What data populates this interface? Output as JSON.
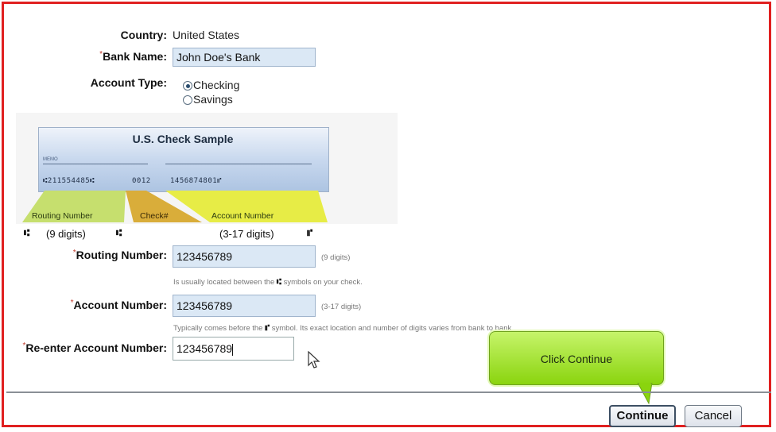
{
  "form": {
    "country_label": "Country:",
    "country_value": "United States",
    "bank_name_label": "Bank Name:",
    "bank_name_value": "John Doe's Bank",
    "account_type_label": "Account Type:",
    "account_type_options": [
      "Checking",
      "Savings"
    ],
    "account_type_selected": "Checking",
    "required_mark": "*"
  },
  "check_sample": {
    "title": "U.S. Check Sample",
    "memo_label": "MEMO",
    "micr_routing": "⑆211554485⑆",
    "micr_check": "0012",
    "micr_account": "1456874801⑈",
    "routing_tab": "Routing Number",
    "check_tab": "Check#",
    "account_tab": "Account Number",
    "routing_symbol": "⑆",
    "account_symbol": "⑈",
    "routing_digits": "(9 digits)",
    "account_digits": "(3-17 digits)"
  },
  "routing": {
    "label": "Routing Number:",
    "value": "123456789",
    "digits_hint": "(9 digits)",
    "help_before": "Is usually located between the",
    "help_after": "symbols on your check."
  },
  "account": {
    "label": "Account Number:",
    "value": "123456789",
    "digits_hint": "(3-17 digits)",
    "help_before": "Typically comes before the",
    "help_after": "symbol. Its exact location and number of digits varies from bank to bank."
  },
  "reenter": {
    "label": "Re-enter Account Number:",
    "value": "123456789"
  },
  "tooltip": {
    "text": "Click Continue"
  },
  "buttons": {
    "continue": "Continue",
    "cancel": "Cancel"
  },
  "colors": {
    "frame": "#e02020",
    "tooltip": "#8ad40e",
    "input_bg": "#dbe8f5"
  }
}
